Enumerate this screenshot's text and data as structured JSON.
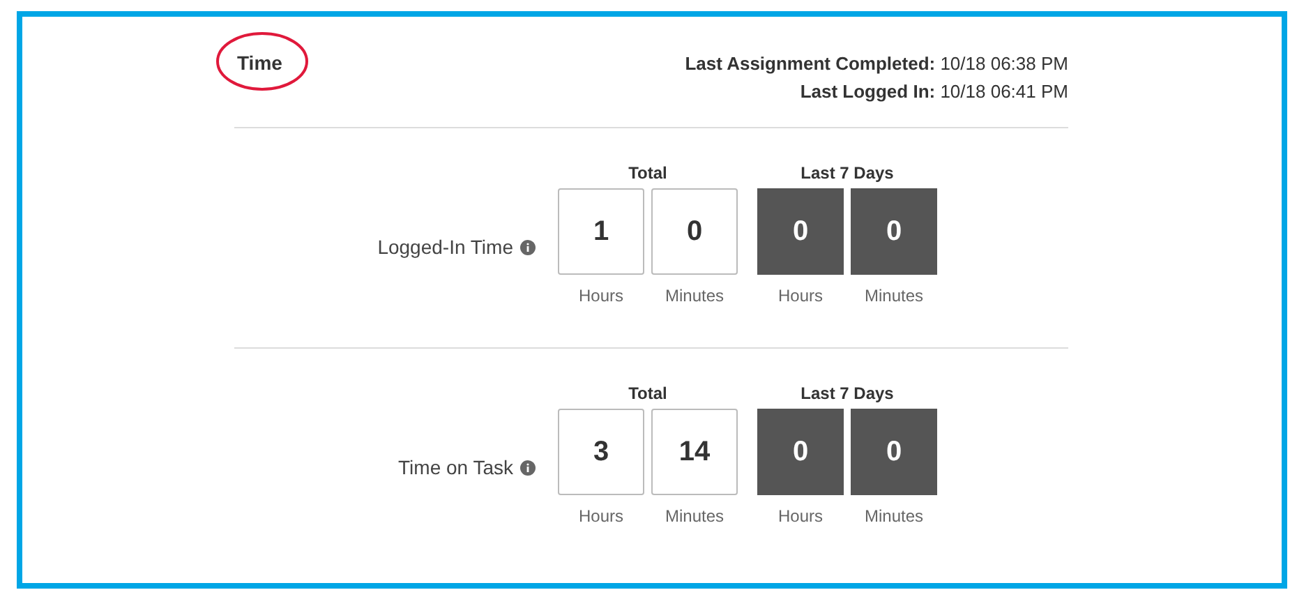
{
  "title": "Time",
  "meta": [
    {
      "label": "Last Assignment Completed:",
      "value": "10/18 06:38 PM"
    },
    {
      "label": "Last Logged In:",
      "value": "10/18 06:41 PM"
    }
  ],
  "sections": [
    {
      "label": "Logged-In Time",
      "groups": [
        {
          "heading": "Total",
          "kind": "light",
          "cells": [
            {
              "value": "1",
              "unit": "Hours"
            },
            {
              "value": "0",
              "unit": "Minutes"
            }
          ]
        },
        {
          "heading": "Last 7 Days",
          "kind": "dark",
          "cells": [
            {
              "value": "0",
              "unit": "Hours"
            },
            {
              "value": "0",
              "unit": "Minutes"
            }
          ]
        }
      ]
    },
    {
      "label": "Time on Task",
      "groups": [
        {
          "heading": "Total",
          "kind": "light",
          "cells": [
            {
              "value": "3",
              "unit": "Hours"
            },
            {
              "value": "14",
              "unit": "Minutes"
            }
          ]
        },
        {
          "heading": "Last 7 Days",
          "kind": "dark",
          "cells": [
            {
              "value": "0",
              "unit": "Hours"
            },
            {
              "value": "0",
              "unit": "Minutes"
            }
          ]
        }
      ]
    }
  ]
}
